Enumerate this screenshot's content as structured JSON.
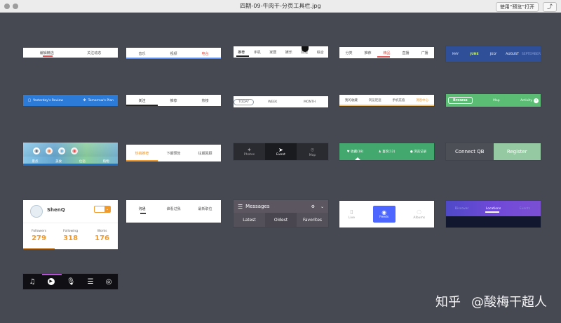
{
  "window": {
    "title": "四期-09-牛肉干-分页工具栏.jpg",
    "open_button": "使用“预览”打开",
    "share_icon": "share-icon"
  },
  "watermark": {
    "main": "知乎",
    "handle": "@酸梅干超人"
  },
  "cards": {
    "c11": {
      "tabs": [
        "编辑精选",
        "关注动态"
      ],
      "active": 0,
      "accent": "#e55656"
    },
    "c12": {
      "tabs": [
        "音乐",
        "视频",
        "电台"
      ],
      "active": 2,
      "accent": "#e55656"
    },
    "c13": {
      "tabs": [
        "推荐",
        "手机",
        "家居",
        "娱乐",
        "财经",
        "综合"
      ],
      "active": 0,
      "accent": "#222222"
    },
    "c14": {
      "tabs": [
        "分类",
        "推荐",
        "精品",
        "直播",
        "广播"
      ],
      "active": 2,
      "accent": "#e55656"
    },
    "c15": {
      "months": [
        "MAY",
        "JUNE",
        "JULY",
        "AUGUST",
        "SEPTEMBER"
      ],
      "active": 1,
      "accent": "#c7f25b"
    },
    "c21": {
      "left_label": "Yesterday's Review",
      "right_label": "Tomorrow's Plan",
      "bg": "#2d7bd8"
    },
    "c22": {
      "tabs": [
        "关注",
        "推荐",
        "热榜"
      ],
      "active": 0,
      "accent": "#222222"
    },
    "c23": {
      "tabs": [
        "TODAY",
        "WEEK",
        "MONTH"
      ],
      "active": 0
    },
    "c24": {
      "tabs": [
        "我的收藏",
        "浏览足迹",
        "手机充值",
        "消息中心"
      ],
      "active": 3,
      "accent": "#f09a2c"
    },
    "c25": {
      "tabs": [
        "Browse",
        "Map",
        "Activity"
      ],
      "active": 0,
      "bg": "#5bbd73"
    },
    "c31": {
      "items": [
        "景点",
        "美食",
        "住宿",
        "购物"
      ],
      "active": 2,
      "accent": "#df6c5a"
    },
    "c32": {
      "tabs": [
        "热销推荐",
        "下期预告",
        "往期回顾"
      ],
      "active": 0,
      "accent": "#f09a2c"
    },
    "c33": {
      "tabs": [
        "Photos",
        "Event",
        "Map"
      ],
      "active": 1,
      "bg": "#2a2b30"
    },
    "c34": {
      "tabs": [
        "收藏(18)",
        "喜欢(12)",
        "浏览记录"
      ],
      "active": 0,
      "bg": "#43a86d"
    },
    "c35": {
      "left": "Connect QB",
      "right": "Register",
      "left_bg": "#4d4f57",
      "right_bg": "#95c9a1"
    },
    "c41": {
      "name": "ShenQ",
      "stats": [
        {
          "label": "Followers",
          "value": "279"
        },
        {
          "label": "Following",
          "value": "318"
        },
        {
          "label": "Works",
          "value": "176"
        }
      ],
      "accent": "#f09a2c"
    },
    "c42": {
      "tabs": [
        "沟通",
        "谁看过我",
        "最新职位"
      ],
      "active": 0,
      "accent": "#222222"
    },
    "c43": {
      "title": "Messages",
      "tabs": [
        "Latest",
        "Oldest",
        "Favorites"
      ],
      "active": 1
    },
    "c44": {
      "tabs": [
        "Live",
        "Feeds",
        "Albums"
      ],
      "active": 1,
      "accent": "#4c66ff"
    },
    "c45": {
      "tabs": [
        "Discover",
        "Locations",
        "Events"
      ],
      "active": 1
    },
    "c51": {
      "icons": [
        "music-note-icon",
        "play-icon",
        "mic-icon",
        "list-icon",
        "podcast-icon"
      ],
      "active": 0,
      "accent": "#b451d6"
    }
  }
}
